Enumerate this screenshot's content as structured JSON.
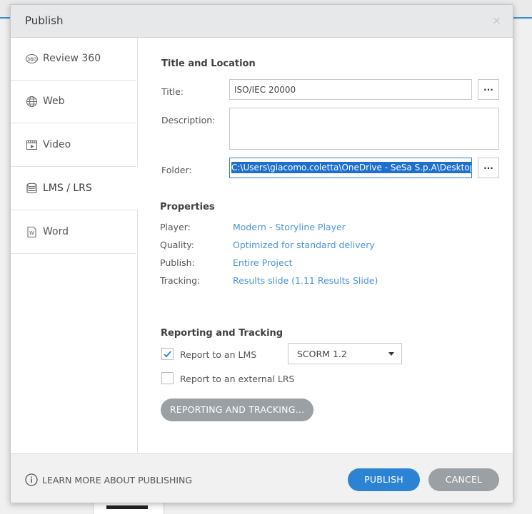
{
  "dialog": {
    "title": "Publish",
    "close_glyph": "×"
  },
  "sidebar": {
    "items": [
      {
        "label": "Review 360",
        "icon": "review-360-icon",
        "active": false
      },
      {
        "label": "Web",
        "icon": "globe-icon",
        "active": false
      },
      {
        "label": "Video",
        "icon": "film-icon",
        "active": false
      },
      {
        "label": "LMS / LRS",
        "icon": "database-icon",
        "active": true
      },
      {
        "label": "Word",
        "icon": "word-document-icon",
        "active": false
      }
    ]
  },
  "title_location": {
    "heading": "Title and Location",
    "title_label": "Title:",
    "title_value": "ISO/IEC 20000",
    "description_label": "Description:",
    "description_value": "",
    "folder_label": "Folder:",
    "folder_value": "C:\\Users\\giacomo.coletta\\OneDrive - SeSa S.p.A\\Desktop",
    "browse_label": "..."
  },
  "properties": {
    "heading": "Properties",
    "rows": [
      {
        "label": "Player:",
        "value": "Modern - Storyline Player"
      },
      {
        "label": "Quality:",
        "value": "Optimized for standard delivery"
      },
      {
        "label": "Publish:",
        "value": "Entire Project"
      },
      {
        "label": "Tracking:",
        "value": "Results slide (1.11 Results Slide)"
      }
    ]
  },
  "reporting": {
    "heading": "Reporting and Tracking",
    "lms_label": "Report to an LMS",
    "lms_checked": true,
    "lms_standard": "SCORM 1.2",
    "lrs_label": "Report to an external LRS",
    "lrs_checked": false,
    "button_label": "REPORTING AND TRACKING..."
  },
  "footer": {
    "learn_more": "LEARN MORE ABOUT PUBLISHING",
    "publish_label": "PUBLISH",
    "cancel_label": "CANCEL"
  },
  "colors": {
    "accent": "#2c83d3",
    "link": "#4a94d6",
    "button_gray": "#9aa0a4",
    "selection": "#1f6fd1"
  }
}
